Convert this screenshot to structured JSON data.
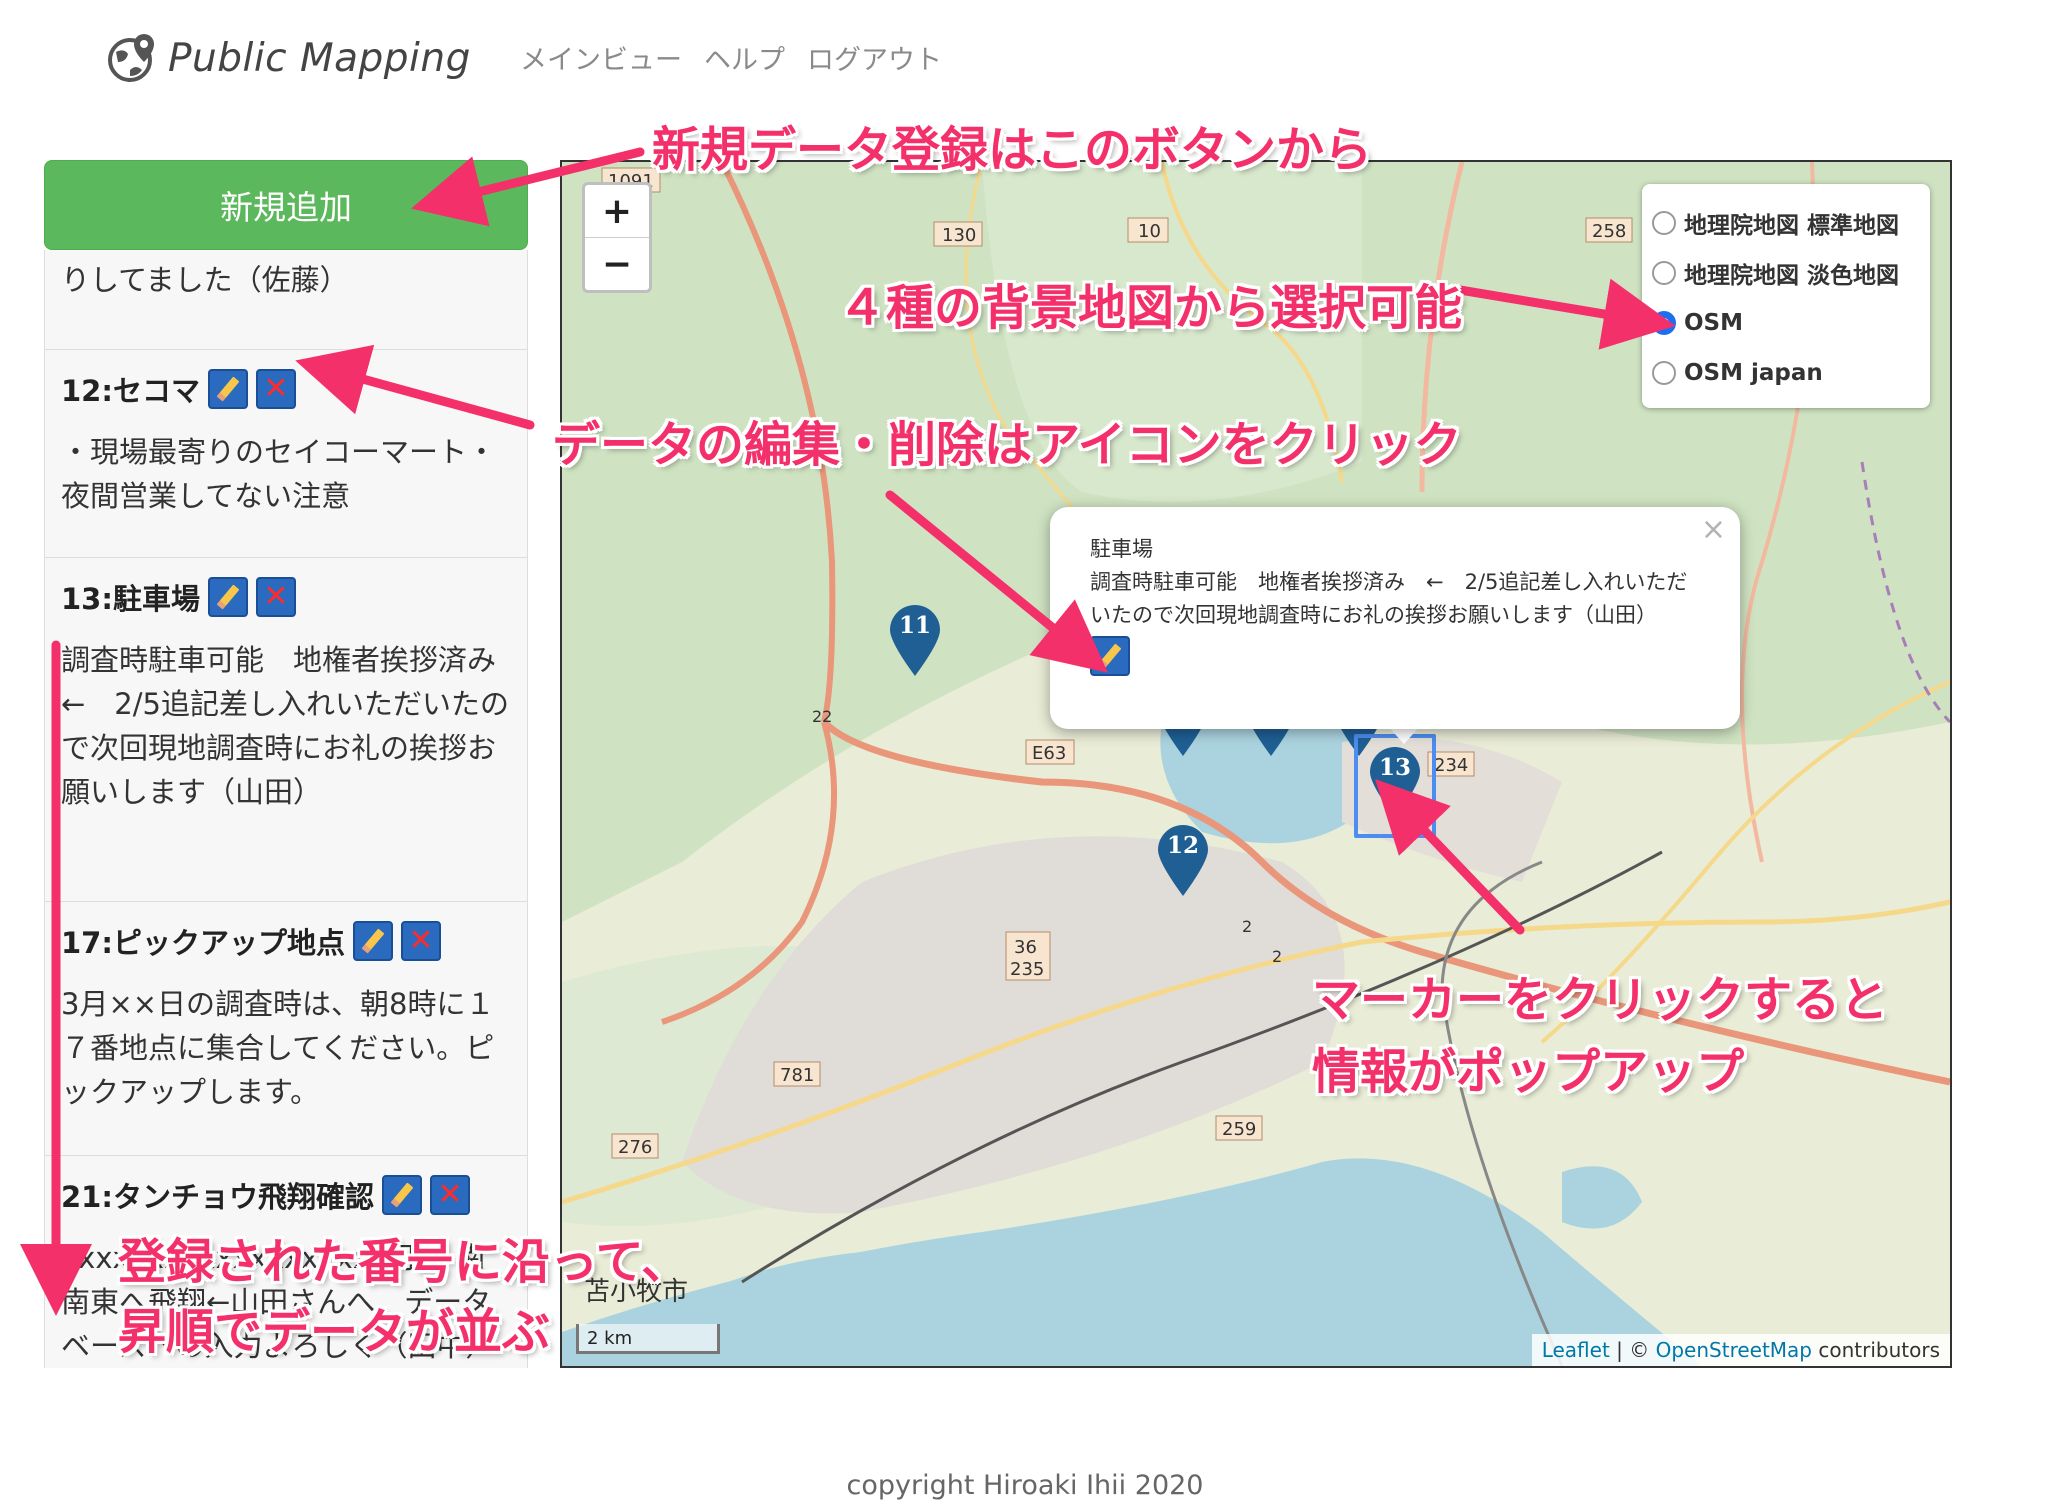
{
  "brand": {
    "name": "Public Mapping"
  },
  "nav": [
    "メインビュー",
    "ヘルプ",
    "ログアウト"
  ],
  "sidebar": {
    "add_button": "新規追加",
    "partial_text": "りしてました（佐藤）",
    "items": [
      {
        "title": "12:セコマ",
        "body": "・現場最寄りのセイコーマート・夜間営業してない注意"
      },
      {
        "title": "13:駐車場",
        "body": "調査時駐車可能　地権者挨拶済み　←　2/5追記差し入れいただいたので次回現地調査時にお礼の挨拶お願いします（山田）"
      },
      {
        "title": "17:ピックアップ地点",
        "body": "3月××日の調査時は、朝8時に１７番地点に集合してください。ピックアップします。"
      },
      {
        "title": "21:タンチョウ飛翔確認",
        "body": "xxxxxxxxxxxxxxxxxx２羽　南南東へ飛翔←山田さんへ　データベースへの入力よろしく（田中）"
      }
    ]
  },
  "map": {
    "zoom_in": "+",
    "zoom_out": "−",
    "layers": [
      {
        "label": "地理院地図 標準地図",
        "selected": false
      },
      {
        "label": "地理院地図 淡色地図",
        "selected": false
      },
      {
        "label": "OSM",
        "selected": true
      },
      {
        "label": "OSM japan",
        "selected": false
      }
    ],
    "popup": {
      "title": "駐車場",
      "text": "調査時駐車可能　地権者挨拶済み　←　2/5追記差し入れいただいたので次回現地調査時にお礼の挨拶お願いします（山田）",
      "close": "×"
    },
    "markers": [
      "11",
      "12",
      "13"
    ],
    "road_labels": [
      "1091",
      "130",
      "10",
      "258",
      "22",
      "E63",
      "234",
      "36",
      "235",
      "781",
      "276",
      "259",
      "2",
      "2"
    ],
    "city_label": "苫小牧市",
    "scale": "2 km",
    "attribution": {
      "leaflet": "Leaflet",
      "sep": " | © ",
      "osm": "OpenStreetMap",
      "suffix": " contributors"
    }
  },
  "annotations": {
    "add": "新規データ登録はこのボタンから",
    "layers": "４種の背景地図から選択可能",
    "edit": "データの編集・削除はアイコンをクリック",
    "marker_line1": "マーカーをクリックすると",
    "marker_line2": "情報がポップアップ",
    "order_line1": "登録された番号に沿って、",
    "order_line2": "昇順でデータが並ぶ"
  },
  "colors": {
    "accent": "#f4306a",
    "add_button": "#5cb85c",
    "marker": "#1f5f94",
    "link": "#0078a8"
  },
  "footer": "copyright Hiroaki Ihii 2020"
}
